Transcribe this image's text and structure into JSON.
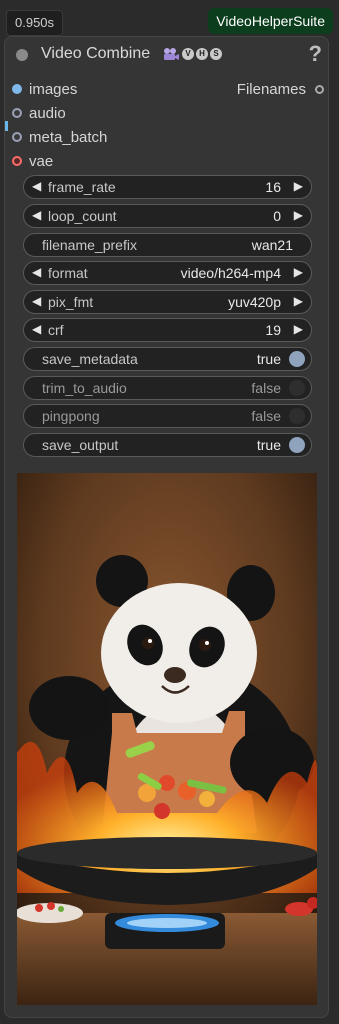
{
  "timing": "0.950s",
  "badge": "VideoHelperSuite",
  "title": "Video Combine",
  "title_icons": [
    "film-icon",
    "V",
    "H",
    "S"
  ],
  "help": "?",
  "inputs": [
    {
      "label": "images",
      "color": "#7fb8ea"
    },
    {
      "label": "audio",
      "color": "#9aa0b8"
    },
    {
      "label": "meta_batch",
      "color": "#9aa0b8"
    },
    {
      "label": "vae",
      "color": "#ff6b6b"
    }
  ],
  "output": {
    "label": "Filenames"
  },
  "widgets": {
    "frame_rate": {
      "name": "frame_rate",
      "value": "16"
    },
    "loop_count": {
      "name": "loop_count",
      "value": "0"
    },
    "filename_prefix": {
      "name": "filename_prefix",
      "value": "wan21"
    },
    "format": {
      "name": "format",
      "value": "video/h264-mp4"
    },
    "pix_fmt": {
      "name": "pix_fmt",
      "value": "yuv420p"
    },
    "crf": {
      "name": "crf",
      "value": "19"
    },
    "save_metadata": {
      "name": "save_metadata",
      "value": "true",
      "on": true
    },
    "trim_to_audio": {
      "name": "trim_to_audio",
      "value": "false",
      "on": false
    },
    "pingpong": {
      "name": "pingpong",
      "value": "false",
      "on": false
    },
    "save_output": {
      "name": "save_output",
      "value": "true",
      "on": true
    }
  },
  "preview": {
    "subject": "panda-chef-cooking-wok"
  }
}
